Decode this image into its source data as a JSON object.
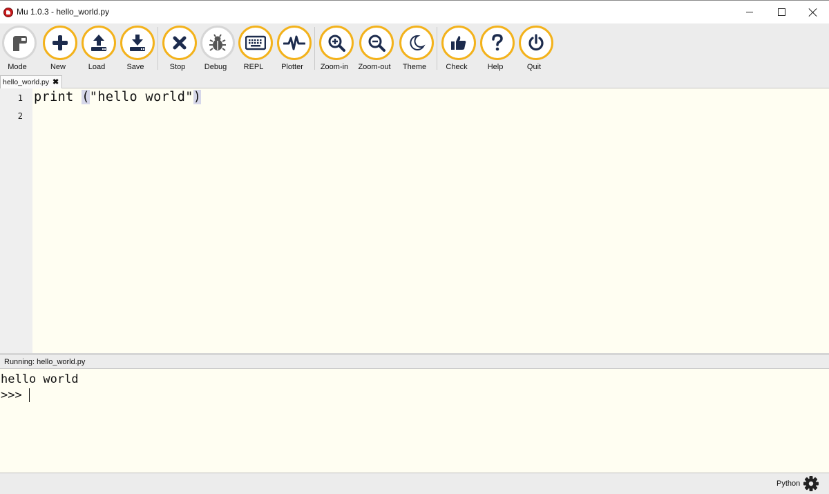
{
  "window": {
    "title": "Mu 1.0.3 - hello_world.py"
  },
  "toolbar": {
    "buttons": [
      {
        "label": "Mode",
        "icon": "mode-icon"
      },
      {
        "label": "New",
        "icon": "plus-icon"
      },
      {
        "label": "Load",
        "icon": "upload-icon"
      },
      {
        "label": "Save",
        "icon": "download-icon"
      },
      {
        "label": "Stop",
        "icon": "close-icon"
      },
      {
        "label": "Debug",
        "icon": "bug-icon"
      },
      {
        "label": "REPL",
        "icon": "keyboard-icon"
      },
      {
        "label": "Plotter",
        "icon": "pulse-icon"
      },
      {
        "label": "Zoom-in",
        "icon": "zoom-in-icon"
      },
      {
        "label": "Zoom-out",
        "icon": "zoom-out-icon"
      },
      {
        "label": "Theme",
        "icon": "moon-icon"
      },
      {
        "label": "Check",
        "icon": "thumbs-up-icon"
      },
      {
        "label": "Help",
        "icon": "question-icon"
      },
      {
        "label": "Quit",
        "icon": "power-icon"
      }
    ]
  },
  "tabs": [
    {
      "label": "hello_world.py",
      "close": "✖"
    }
  ],
  "editor": {
    "line_numbers": [
      "1",
      "2"
    ],
    "code_before": "print ",
    "code_paren_open": "(",
    "code_string": "\"hello world\"",
    "code_paren_close": ")"
  },
  "repl": {
    "title": "Running: hello_world.py",
    "output": "hello world",
    "prompt": ">>> "
  },
  "status": {
    "mode": "Python"
  },
  "colors": {
    "accent": "#f3b21b",
    "icon": "#1c2b4d",
    "editor_bg": "#fffef2"
  }
}
